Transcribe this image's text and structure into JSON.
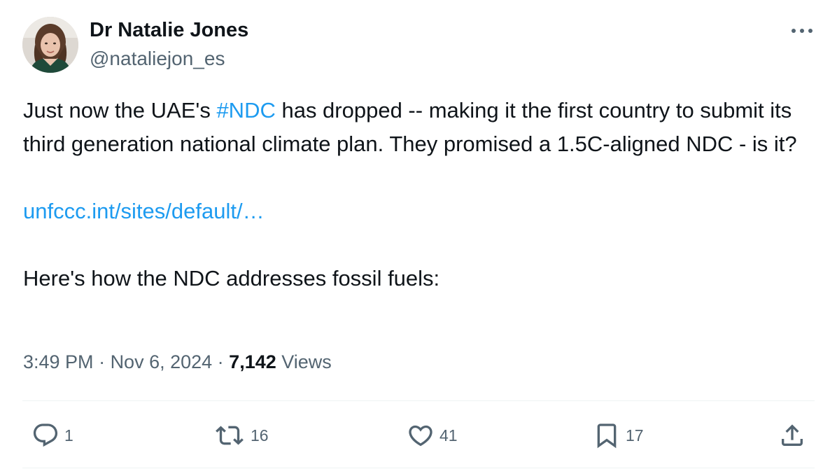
{
  "author": {
    "display_name": "Dr Natalie Jones",
    "handle": "@nataliejon_es"
  },
  "tweet": {
    "text_part1": "Just now the UAE's ",
    "hashtag": "#NDC",
    "text_part2": " has dropped -- making it the first country to submit its third generation national climate plan. They promised a 1.5C-aligned NDC - is it?",
    "link": "unfccc.int/sites/default/…",
    "text_part3": "Here's how the NDC addresses fossil fuels:"
  },
  "meta": {
    "time": "3:49 PM",
    "separator": " · ",
    "date": "Nov 6, 2024",
    "views_count": "7,142",
    "views_label": " Views"
  },
  "actions": {
    "reply_count": "1",
    "retweet_count": "16",
    "like_count": "41",
    "bookmark_count": "17"
  },
  "colors": {
    "link": "#1d9bf0",
    "secondary_text": "#536471",
    "primary_text": "#0f1419"
  },
  "icons": {
    "more": "more-horizontal-icon",
    "reply": "reply-icon",
    "retweet": "retweet-icon",
    "like": "heart-icon",
    "bookmark": "bookmark-icon",
    "share": "share-icon"
  }
}
